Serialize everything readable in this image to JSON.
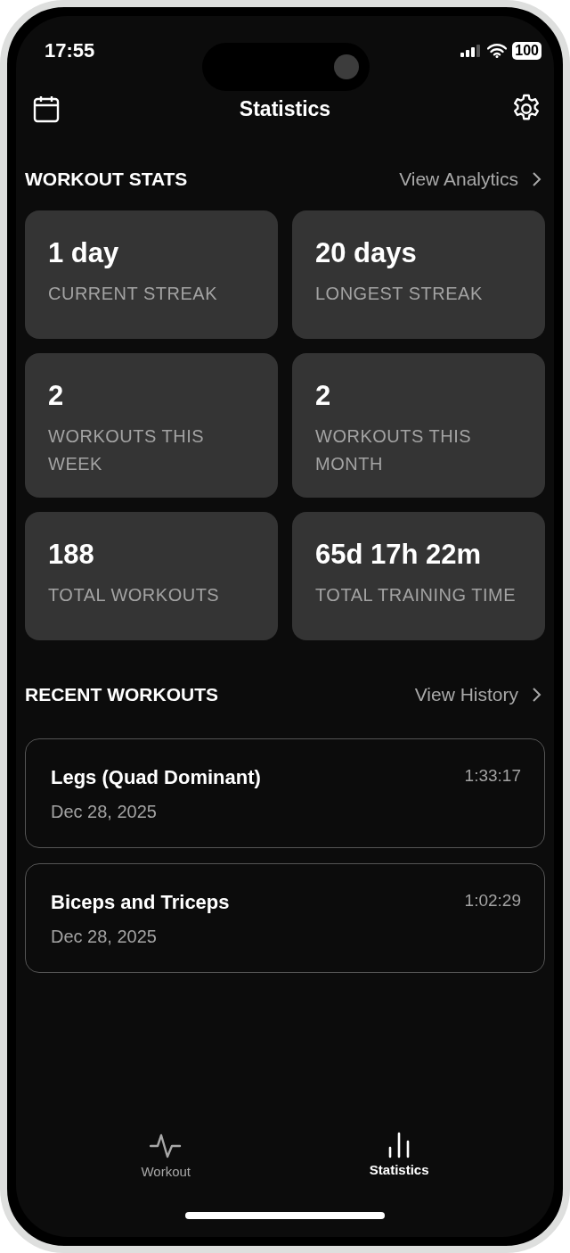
{
  "status_bar": {
    "time": "17:55",
    "battery": "100"
  },
  "header": {
    "title": "Statistics"
  },
  "workout_stats": {
    "title": "WORKOUT STATS",
    "link": "View Analytics",
    "cards": [
      {
        "value": "1 day",
        "label": "CURRENT STREAK"
      },
      {
        "value": "20 days",
        "label": "LONGEST STREAK"
      },
      {
        "value": "2",
        "label": "WORKOUTS THIS WEEK"
      },
      {
        "value": "2",
        "label": "WORKOUTS THIS MONTH"
      },
      {
        "value": "188",
        "label": "TOTAL WORKOUTS"
      },
      {
        "value": "65d 17h 22m",
        "label": "TOTAL TRAINING TIME"
      }
    ]
  },
  "recent_workouts": {
    "title": "RECENT WORKOUTS",
    "link": "View History",
    "items": [
      {
        "name": "Legs (Quad Dominant)",
        "date": "Dec 28, 2025",
        "duration": "1:33:17"
      },
      {
        "name": "Biceps and Triceps",
        "date": "Dec 28, 2025",
        "duration": "1:02:29"
      }
    ]
  },
  "tabs": [
    {
      "label": "Workout",
      "kind": "pulse",
      "selected": false
    },
    {
      "label": "Statistics",
      "kind": "bars",
      "selected": true
    }
  ]
}
